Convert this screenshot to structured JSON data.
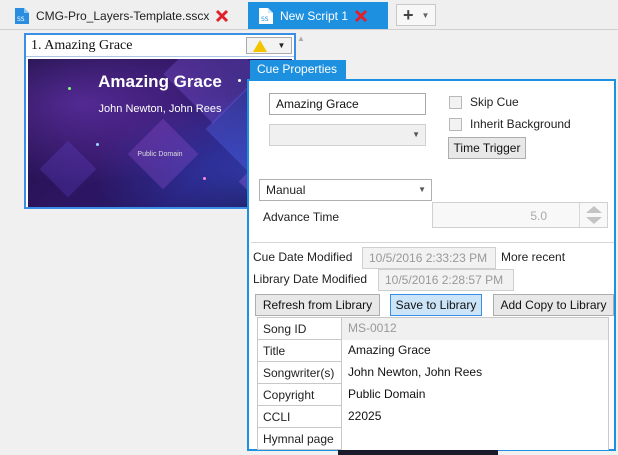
{
  "tabs": [
    {
      "label": "CMG-Pro_Layers-Template.sscx",
      "active": false
    },
    {
      "label": "New Script 1",
      "active": true
    }
  ],
  "icons": {
    "doc": "document-icon",
    "close": "close-icon",
    "add": "plus-icon",
    "warning": "warning-icon",
    "caret": "chevron-down-icon"
  },
  "colors": {
    "accent": "#1e90e0",
    "close_red": "#e0202a",
    "warning": "#f5c400"
  },
  "cue": {
    "title": "1. Amazing Grace",
    "slide": {
      "title": "Amazing Grace",
      "authors": "John Newton, John Rees",
      "footer": "Public Domain"
    }
  },
  "cue_properties": {
    "tab_label": "Cue Properties",
    "title_value": "Amazing Grace",
    "layout_select": "",
    "skip_cue_label": "Skip Cue",
    "inherit_bg_label": "Inherit Background",
    "time_trigger_label": "Time Trigger",
    "advance_mode": "Manual",
    "advance_time_label": "Advance Time",
    "advance_time_value": "5.0",
    "cue_date_label": "Cue Date Modified",
    "cue_date_value": "10/5/2016 2:33:23 PM",
    "more_recent_label": "More recent",
    "library_date_label": "Library Date Modified",
    "library_date_value": "10/5/2016 2:28:57 PM",
    "refresh_label": "Refresh from Library",
    "save_label": "Save to Library",
    "add_copy_label": "Add Copy to Library"
  },
  "song_properties": [
    {
      "key": "Song ID",
      "value": "MS-0012",
      "disabled": true
    },
    {
      "key": "Title",
      "value": "Amazing Grace",
      "disabled": false
    },
    {
      "key": "Songwriter(s)",
      "value": "John Newton, John Rees",
      "disabled": false
    },
    {
      "key": "Copyright",
      "value": "Public Domain",
      "disabled": false
    },
    {
      "key": "CCLI",
      "value": "22025",
      "disabled": false
    },
    {
      "key": "Hymnal page",
      "value": "",
      "disabled": false
    }
  ]
}
